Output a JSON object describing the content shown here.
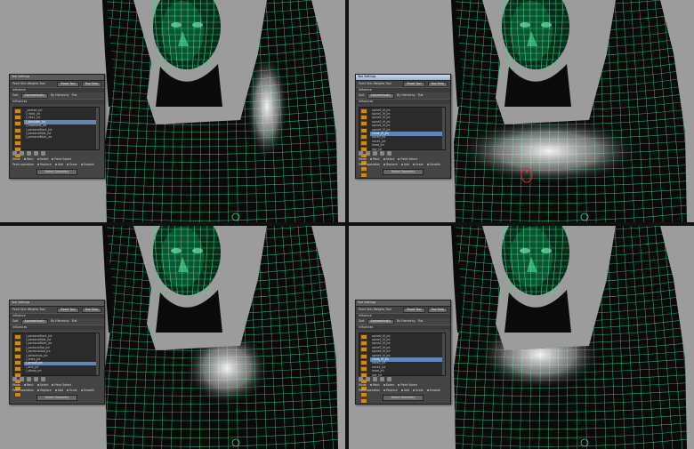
{
  "panels": [
    {
      "title": "Tool Settings",
      "tool_name": "Paint Skin Weights Tool",
      "reset_label": "Reset Tool",
      "help_label": "Tool Help",
      "section_influence": "Influence",
      "sort_label": "Sort",
      "sort_value": "Alphabetically",
      "sort_opt2": "By Hierarchy",
      "sort_opt3": "Flat",
      "section_influences": "Influences",
      "items": [
        "_pectorl_jnt",
        "l_ribs0_jnt",
        "l_ribs1_jnt",
        "l_shoulder_jnt",
        "l_trapezius_jnt",
        "l_pectoralFront_jnt",
        "l_pectoralSide_jnt",
        "l_pectoralBack_jnt"
      ],
      "selected_index": 3,
      "mode_label": "Mode",
      "mode_paint": "Paint",
      "mode_select": "Select",
      "mode_paint_select": "Paint Select",
      "op_label": "Paint operation",
      "op_replace": "Replace",
      "op_add": "Add",
      "op_scale": "Scale",
      "op_smooth": "Smooth",
      "button_wide": "Select Geometry",
      "title_style": "gray"
    },
    {
      "title": "Tool Settings",
      "tool_name": "Paint Skin Weights Tool",
      "reset_label": "Reset Tool",
      "help_label": "Tool Help",
      "section_influence": "Influence",
      "sort_label": "Sort",
      "sort_value": "Alphabetically",
      "sort_opt2": "By Hierarchy",
      "sort_opt3": "Flat",
      "section_influences": "Influences",
      "items": [
        "spine0_M_jnt",
        "spine1_M_jnt",
        "spine2_M_jnt",
        "spine3_M_jnt",
        "spine4_M_jnt",
        "spine5_M_jnt",
        "chest_M_jnt",
        "neck0_jnt",
        "neck1_jnt",
        "head_jnt",
        "jaw_jnt"
      ],
      "selected_index": 6,
      "mode_label": "Mode",
      "mode_paint": "Paint",
      "mode_select": "Select",
      "mode_paint_select": "Paint Select",
      "op_label": "Paint operation",
      "op_replace": "Replace",
      "op_add": "Add",
      "op_scale": "Scale",
      "op_smooth": "Smooth",
      "button_wide": "Select Geometry",
      "title_style": "blue"
    },
    {
      "title": "Tool Settings",
      "tool_name": "Paint Skin Weights Tool",
      "reset_label": "Reset Tool",
      "help_label": "Tool Help",
      "section_influence": "Influence",
      "sort_label": "Sort",
      "sort_value": "Alphabetically",
      "sort_opt2": "By Hierarchy",
      "sort_opt3": "Flat",
      "section_influences": "Influences",
      "items": [
        "l_pectoralFront_jnt",
        "l_pectoralSide_jnt",
        "l_pectoralBack_jnt",
        "l_pectoralTop_jnt",
        "l_pectoralLow_jnt",
        "l_latissimus_jnt",
        "l_teres_jnt",
        "l_armpit_jnt",
        "l_arm_jnt",
        "l_elbow_jnt"
      ],
      "selected_index": 7,
      "mode_label": "Mode",
      "mode_paint": "Paint",
      "mode_select": "Select",
      "mode_paint_select": "Paint Select",
      "op_label": "Paint operation",
      "op_replace": "Replace",
      "op_add": "Add",
      "op_scale": "Scale",
      "op_smooth": "Smooth",
      "button_wide": "Select Geometry",
      "title_style": "gray"
    },
    {
      "title": "Tool Settings",
      "tool_name": "Paint Skin Weights Tool",
      "reset_label": "Reset Tool",
      "help_label": "Tool Help",
      "section_influence": "Influence",
      "sort_label": "Sort",
      "sort_value": "Alphabetically",
      "sort_opt2": "By Hierarchy",
      "sort_opt3": "Flat",
      "section_influences": "Influences",
      "items": [
        "spine0_M_jnt",
        "spine1_M_jnt",
        "spine2_M_jnt",
        "spine3_M_jnt",
        "spine4_M_jnt",
        "spine5_M_jnt",
        "chest_M_jnt",
        "neck0_jnt",
        "neck1_jnt",
        "head_jnt",
        "jaw_jnt"
      ],
      "selected_index": 6,
      "mode_label": "Mode",
      "mode_paint": "Paint",
      "mode_select": "Select",
      "mode_paint_select": "Paint Select",
      "op_label": "Paint operation",
      "op_replace": "Replace",
      "op_add": "Add",
      "op_scale": "Scale",
      "op_smooth": "Smooth",
      "button_wide": "Select Geometry",
      "title_style": "gray"
    }
  ],
  "colors": {
    "viewport_bg": "#9c9c9c",
    "mesh_wire": "#2ee08a",
    "mesh_body": "#0a0a0a",
    "weight_highlight": "#ffffff",
    "brush_ring": "#e03030"
  },
  "views": [
    {
      "highlight": "armpit"
    },
    {
      "highlight": "chest-band",
      "brush": true
    },
    {
      "highlight": "armpit-low"
    },
    {
      "highlight": "chest-band-soft"
    }
  ]
}
